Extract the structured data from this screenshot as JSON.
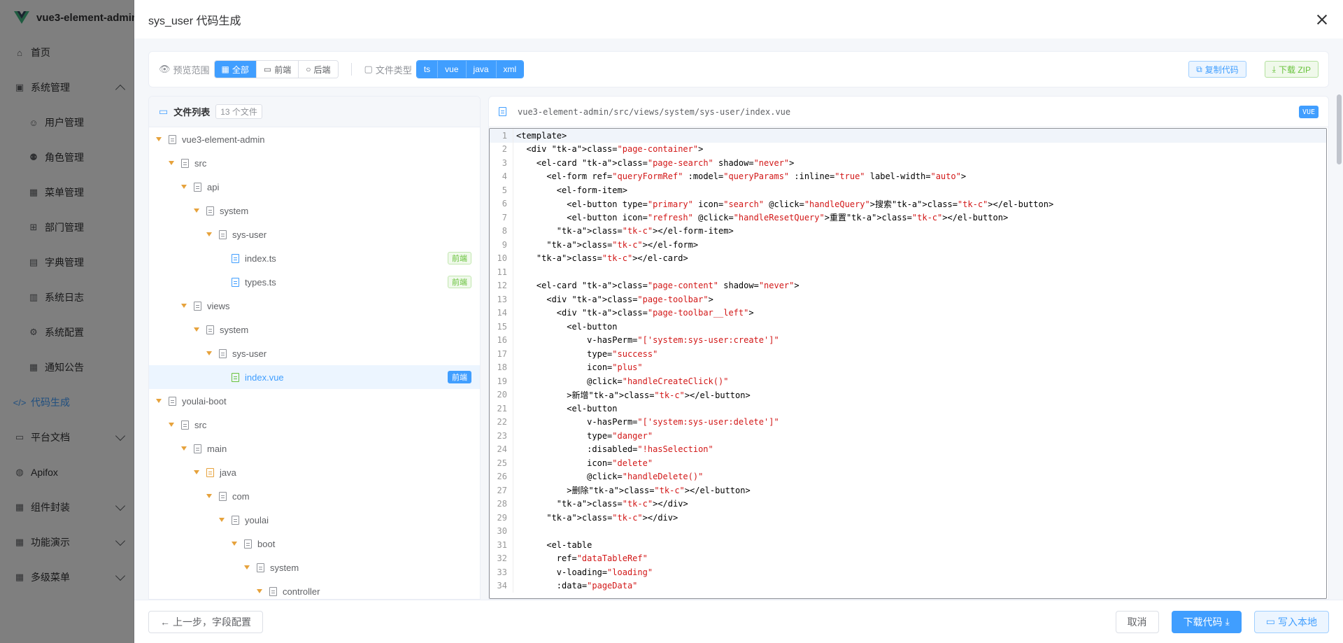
{
  "sidebar": {
    "logo_title": "vue3-element-admin",
    "items": [
      {
        "label": "首页",
        "icon": "home-icon"
      },
      {
        "label": "系统管理",
        "icon": "system-icon"
      },
      {
        "label": "用户管理",
        "icon": "user-icon"
      },
      {
        "label": "角色管理",
        "icon": "role-icon"
      },
      {
        "label": "菜单管理",
        "icon": "menu-icon"
      },
      {
        "label": "部门管理",
        "icon": "dept-icon"
      },
      {
        "label": "字典管理",
        "icon": "dict-icon"
      },
      {
        "label": "系统日志",
        "icon": "log-icon"
      },
      {
        "label": "系统配置",
        "icon": "config-icon"
      },
      {
        "label": "通知公告",
        "icon": "notice-icon"
      },
      {
        "label": "代码生成",
        "icon": "code-icon"
      },
      {
        "label": "平台文档",
        "icon": "doc-icon"
      },
      {
        "label": "Apifox",
        "icon": "apifox-icon"
      },
      {
        "label": "组件封装",
        "icon": "component-icon"
      },
      {
        "label": "功能演示",
        "icon": "demo-icon"
      },
      {
        "label": "多级菜单",
        "icon": "multi-menu-icon"
      }
    ]
  },
  "drawer": {
    "title": "sys_user 代码生成"
  },
  "toolbar": {
    "scope_label": "预览范围",
    "scope_options": [
      "全部",
      "前端",
      "后端"
    ],
    "type_label": "文件类型",
    "type_options": [
      "ts",
      "vue",
      "java",
      "xml"
    ],
    "copy_label": "复制代码",
    "zip_label": "下载 ZIP"
  },
  "file_panel": {
    "title": "文件列表",
    "count": "13 个文件",
    "tree": [
      {
        "name": "vue3-element-admin",
        "tag": ""
      },
      {
        "name": "src",
        "tag": ""
      },
      {
        "name": "api",
        "tag": ""
      },
      {
        "name": "system",
        "tag": ""
      },
      {
        "name": "sys-user",
        "tag": ""
      },
      {
        "name": "index.ts",
        "tag": "前端"
      },
      {
        "name": "types.ts",
        "tag": "前端"
      },
      {
        "name": "views",
        "tag": ""
      },
      {
        "name": "system",
        "tag": ""
      },
      {
        "name": "sys-user",
        "tag": ""
      },
      {
        "name": "index.vue",
        "tag": "前端"
      },
      {
        "name": "youlai-boot",
        "tag": ""
      },
      {
        "name": "src",
        "tag": ""
      },
      {
        "name": "main",
        "tag": ""
      },
      {
        "name": "java",
        "tag": ""
      },
      {
        "name": "com",
        "tag": ""
      },
      {
        "name": "youlai",
        "tag": ""
      },
      {
        "name": "boot",
        "tag": ""
      },
      {
        "name": "system",
        "tag": ""
      },
      {
        "name": "controller",
        "tag": ""
      }
    ]
  },
  "code_panel": {
    "path": "vue3-element-admin/src/views/system/sys-user/index.vue",
    "badge": "VUE",
    "lines": [
      "<template>",
      "  <div class=\"page-container\">",
      "    <el-card class=\"page-search\" shadow=\"never\">",
      "      <el-form ref=\"queryFormRef\" :model=\"queryParams\" :inline=\"true\" label-width=\"auto\">",
      "        <el-form-item>",
      "          <el-button type=\"primary\" icon=\"search\" @click=\"handleQuery\">搜索</el-button>",
      "          <el-button icon=\"refresh\" @click=\"handleResetQuery\">重置</el-button>",
      "        </el-form-item>",
      "      </el-form>",
      "    </el-card>",
      "",
      "    <el-card class=\"page-content\" shadow=\"never\">",
      "      <div class=\"page-toolbar\">",
      "        <div class=\"page-toolbar__left\">",
      "          <el-button",
      "              v-hasPerm=\"['system:sys-user:create']\"",
      "              type=\"success\"",
      "              icon=\"plus\"",
      "              @click=\"handleCreateClick()\"",
      "          >新增</el-button>",
      "          <el-button",
      "              v-hasPerm=\"['system:sys-user:delete']\"",
      "              type=\"danger\"",
      "              :disabled=\"!hasSelection\"",
      "              icon=\"delete\"",
      "              @click=\"handleDelete()\"",
      "          >删除</el-button>",
      "        </div>",
      "      </div>",
      "",
      "      <el-table",
      "        ref=\"dataTableRef\"",
      "        v-loading=\"loading\"",
      "        :data=\"pageData\""
    ]
  },
  "footer": {
    "prev_label": "上一步，字段配置",
    "cancel_label": "取消",
    "download_label": "下载代码",
    "write_label": "写入本地"
  },
  "colors": {
    "primary": "#409eff",
    "success": "#67c23a",
    "warning": "#e6a23c"
  }
}
